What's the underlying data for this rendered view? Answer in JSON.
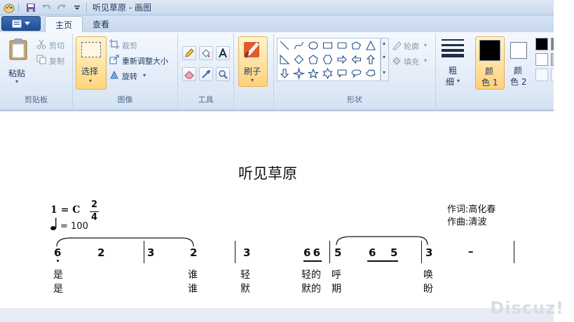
{
  "window": {
    "title": "听见草原 - 画图"
  },
  "tabs": [
    {
      "label": "主页"
    },
    {
      "label": "查看"
    }
  ],
  "ribbon": {
    "clipboard": {
      "group_label": "剪贴板",
      "paste": "粘贴",
      "cut": "剪切",
      "copy": "复制"
    },
    "image": {
      "group_label": "图像",
      "select": "选择",
      "crop": "裁剪",
      "resize": "重新调整大小",
      "rotate": "旋转"
    },
    "tools": {
      "group_label": "工具"
    },
    "brushes": {
      "label": "刷子"
    },
    "shapes": {
      "group_label": "形状",
      "outline": "轮廓",
      "fill": "填充"
    },
    "size": {
      "label_1": "粗",
      "label_2": "细"
    },
    "color1": {
      "label_1": "颜",
      "label_2": "色 1"
    },
    "color2": {
      "label_1": "颜",
      "label_2": "色 2"
    },
    "colors": {
      "color1": "#000000",
      "color2": "#ffffff"
    }
  },
  "sheet": {
    "title": "听见草原",
    "key": "1 = C",
    "time_top": "2",
    "time_bottom": "4",
    "tempo": "= 100",
    "lyricist": "作词:高化春",
    "composer": "作曲:清波",
    "notes": [
      "6",
      "2",
      "3",
      "2",
      "3",
      "6 6",
      "5",
      "6",
      "5",
      "3",
      "–"
    ],
    "lyrics_line1": [
      "是",
      "谁",
      "轻",
      "轻的",
      "呼",
      "唤"
    ],
    "lyrics_line2": [
      "是",
      "谁",
      "默",
      "默的",
      "期",
      "盼"
    ]
  },
  "watermark": "Discuz!"
}
